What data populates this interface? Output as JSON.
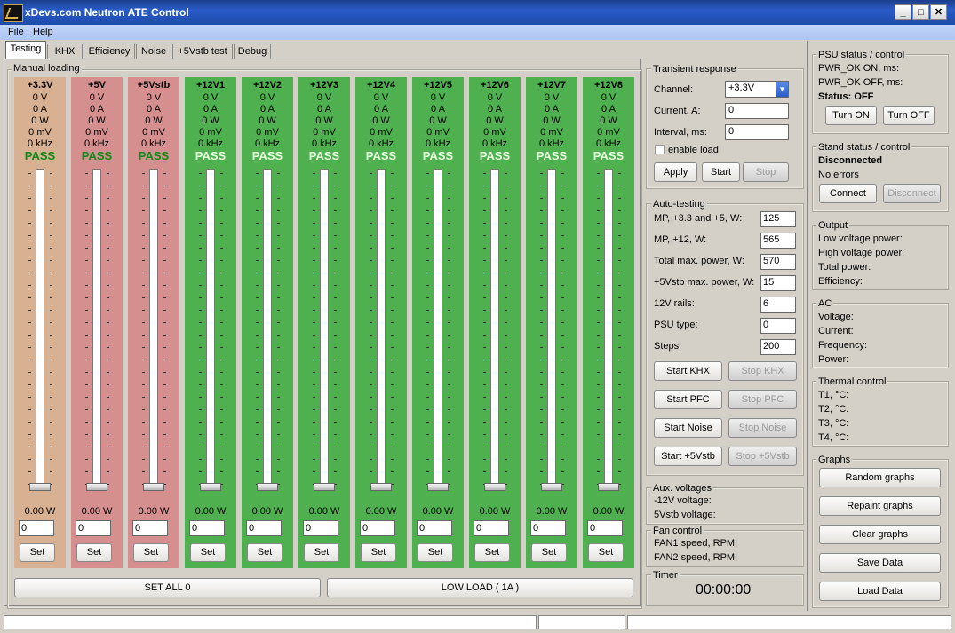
{
  "window": {
    "title": "xDevs.com Neutron ATE Control",
    "min": "_",
    "max": "□",
    "close": "✕"
  },
  "menu": [
    "File",
    "Help"
  ],
  "tabs": [
    "Testing",
    "KHX",
    "Efficiency",
    "Noise",
    "+5Vstb test",
    "Debug"
  ],
  "manual_loading": {
    "label": "Manual loading",
    "rails": [
      {
        "name": "+3.3V",
        "color": "orange"
      },
      {
        "name": "+5V",
        "color": "red"
      },
      {
        "name": "+5Vstb",
        "color": "red"
      },
      {
        "name": "+12V1",
        "color": "green"
      },
      {
        "name": "+12V2",
        "color": "green"
      },
      {
        "name": "+12V3",
        "color": "green"
      },
      {
        "name": "+12V4",
        "color": "green"
      },
      {
        "name": "+12V5",
        "color": "green"
      },
      {
        "name": "+12V6",
        "color": "green"
      },
      {
        "name": "+12V7",
        "color": "green"
      },
      {
        "name": "+12V8",
        "color": "green"
      }
    ],
    "readings": [
      "0 V",
      "0 A",
      "0 W",
      "0 mV",
      "0 kHz"
    ],
    "status": "PASS",
    "power": "0.00 W",
    "input_value": "0",
    "set_label": "Set",
    "set_all": "SET ALL 0",
    "low_load": "LOW LOAD ( 1A )"
  },
  "transient": {
    "label": "Transient response",
    "channel_label": "Channel:",
    "channel_value": "+3.3V",
    "current_label": "Current, A:",
    "current_value": "0",
    "interval_label": "Interval, ms:",
    "interval_value": "0",
    "enable_load": "enable load",
    "apply": "Apply",
    "start": "Start",
    "stop": "Stop"
  },
  "autotest": {
    "label": "Auto-testing",
    "fields": [
      {
        "label": "MP, +3.3 and +5, W:",
        "value": "125"
      },
      {
        "label": "MP, +12, W:",
        "value": "565"
      },
      {
        "label": "Total max. power, W:",
        "value": "570"
      },
      {
        "label": "+5Vstb max. power, W:",
        "value": "15"
      },
      {
        "label": "12V rails:",
        "value": "6"
      },
      {
        "label": "PSU type:",
        "value": "0"
      },
      {
        "label": "Steps:",
        "value": "200"
      }
    ],
    "buttons": [
      {
        "start": "Start KHX",
        "stop": "Stop KHX"
      },
      {
        "start": "Start PFC",
        "stop": "Stop PFC"
      },
      {
        "start": "Start Noise",
        "stop": "Stop Noise"
      },
      {
        "start": "Start +5Vstb",
        "stop": "Stop +5Vstb"
      }
    ]
  },
  "aux": {
    "label": "Aux. voltages",
    "line1": "-12V voltage:",
    "line2": "5Vstb voltage:"
  },
  "fan": {
    "label": "Fan control",
    "line1": "FAN1 speed, RPM:",
    "line2": "FAN2 speed, RPM:"
  },
  "timer": {
    "label": "Timer",
    "value": "00:00:00"
  },
  "psu": {
    "label": "PSU status / control",
    "pwr_on": "PWR_OK ON, ms:",
    "pwr_off": "PWR_OK OFF, ms:",
    "status": "Status: OFF",
    "turn_on": "Turn ON",
    "turn_off": "Turn OFF"
  },
  "stand": {
    "label": "Stand status / control",
    "status": "Disconnected",
    "errors": "No errors",
    "connect": "Connect",
    "disconnect": "Disconnect"
  },
  "output": {
    "label": "Output",
    "lines": [
      "Low voltage power:",
      "High voltage power:",
      "Total power:",
      "Efficiency:"
    ]
  },
  "ac": {
    "label": "AC",
    "lines": [
      "Voltage:",
      "Current:",
      "Frequency:",
      "Power:"
    ]
  },
  "thermal": {
    "label": "Thermal control",
    "lines": [
      "T1, °C:",
      "T2, °C:",
      "T3, °C:",
      "T4, °C:"
    ]
  },
  "graphs": {
    "label": "Graphs",
    "buttons": [
      "Random graphs",
      "Repaint graphs",
      "Clear graphs",
      "Save Data",
      "Load Data"
    ]
  }
}
